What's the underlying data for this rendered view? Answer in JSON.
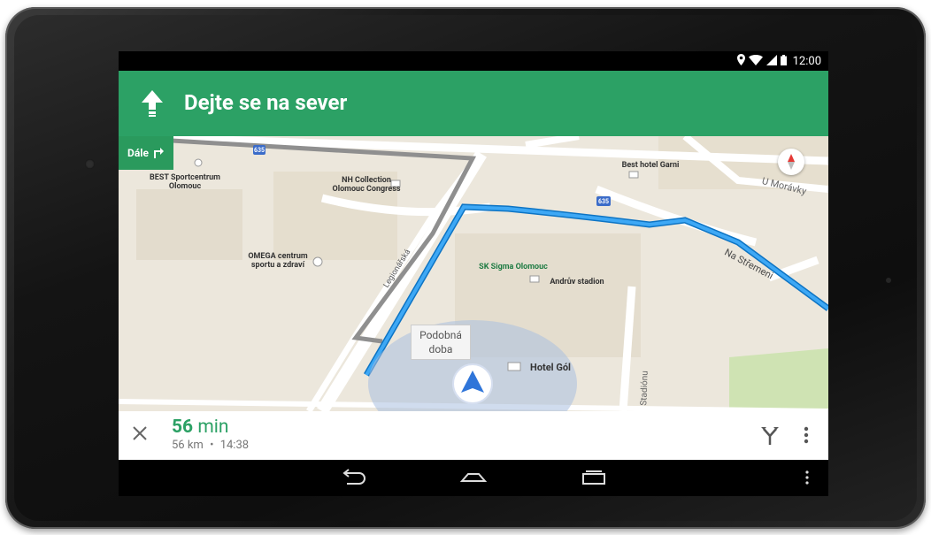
{
  "status_bar": {
    "time": "12:00",
    "icons": [
      "location-icon",
      "wifi-icon",
      "signal-icon",
      "battery-icon"
    ]
  },
  "navigation": {
    "instruction": "Dejte se na sever",
    "direction_icon": "arrow-up-icon",
    "then_chip": {
      "label": "Dále",
      "icon": "turn-right-icon"
    }
  },
  "map": {
    "labels": {
      "best_sportcentrum": "BEST Sportcentrum\nOlomouc",
      "nh_collection": "NH Collection\nOlomouc Congress",
      "best_hotel_garni": "Best hotel Garni",
      "u_moravky": "U Morávky",
      "omega": "OMEGA centrum\nsportu a zdraví",
      "sk_sigma": "SK Sigma Olomouc",
      "andruv_stadion": "Andrův stadion",
      "hotel_gol": "Hotel Gól",
      "na_stremeni": "Na Střemeni",
      "legionarska": "Legionářská",
      "stadionu": "Stadiónu"
    },
    "route_shields": [
      "635",
      "635",
      "635"
    ],
    "alt_route_tooltip": "Podobná\ndoba",
    "colors": {
      "route": "#2196f3",
      "alt_route": "#8a8a8a",
      "nav_green": "#2ca165"
    }
  },
  "trip": {
    "duration_value": "56",
    "duration_unit": "min",
    "distance": "56 km",
    "separator": "•",
    "arrival": "14:38"
  },
  "system_nav": {
    "buttons": [
      "back-icon",
      "home-icon",
      "recents-icon",
      "menu-icon"
    ]
  }
}
